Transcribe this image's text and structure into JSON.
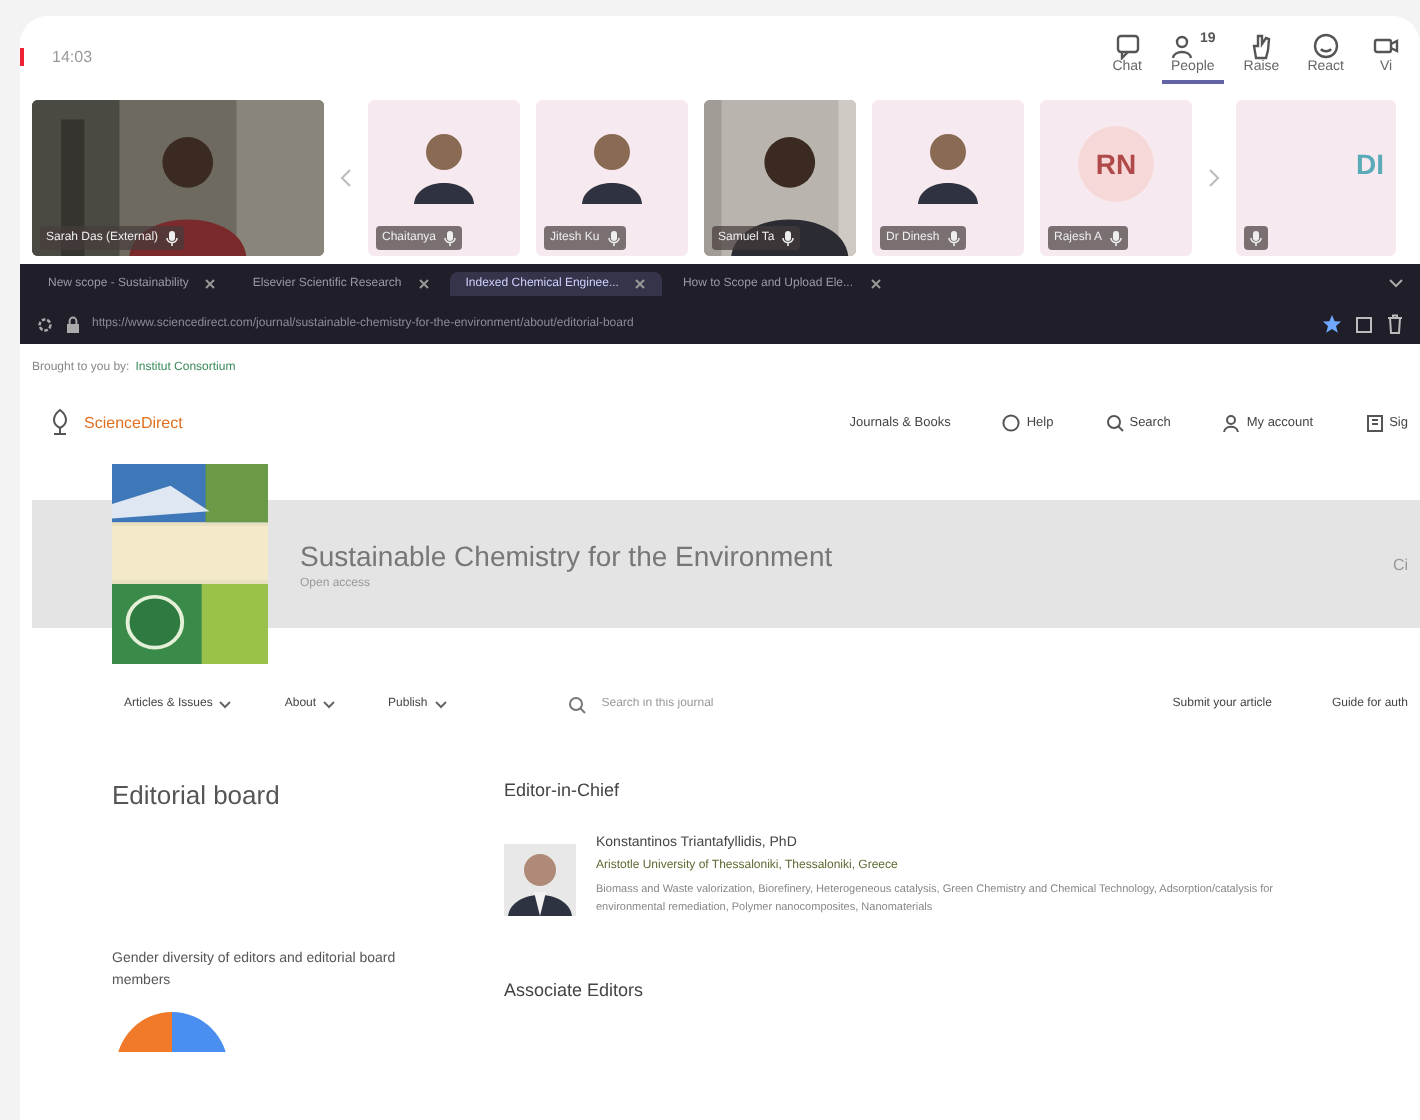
{
  "meeting": {
    "time": "14:03",
    "toolbar": [
      {
        "kind": "chat",
        "label": "Chat",
        "selected": false
      },
      {
        "kind": "people",
        "label": "People",
        "badge": "19",
        "selected": true
      },
      {
        "kind": "raise",
        "label": "Raise",
        "selected": false
      },
      {
        "kind": "react",
        "label": "React",
        "selected": false
      },
      {
        "kind": "view",
        "label": "Vi",
        "selected": false
      }
    ]
  },
  "video_tiles": [
    {
      "kind": "video",
      "name": "Sarah Das (External)",
      "speaking": true
    },
    {
      "name": "Chaitanya",
      "speaking": false
    },
    {
      "name": "Jitesh Ku",
      "speaking": false
    },
    {
      "kind": "video",
      "name": "Samuel Ta",
      "speaking": false
    },
    {
      "name": "Dr Dinesh",
      "speaking": false
    },
    {
      "kind": "initials",
      "initials": "RN",
      "name": "Rajesh A",
      "speaking": false
    },
    {
      "kind": "initials",
      "initials": "DI",
      "speaking": false
    }
  ],
  "browser": {
    "tabs": [
      {
        "label": "New scope - Sustainability",
        "selected": false
      },
      {
        "label": "Elsevier Scientific Research",
        "selected": false
      },
      {
        "label": "Indexed Chemical Enginee...",
        "selected": true
      },
      {
        "label": "How to Scope and Upload Ele...",
        "selected": false
      }
    ],
    "url": "https://www.sciencedirect.com/journal/sustainable-chemistry-for-the-environment/about/editorial-board"
  },
  "page": {
    "site_name": "ScienceDirect",
    "brought_by": "Brought to you by:",
    "institution": "Institut Consortium",
    "site_nav": [
      {
        "kind": "plain",
        "label": "Journals & Books"
      },
      {
        "kind": "help",
        "label": "Help"
      },
      {
        "kind": "search",
        "label": "Search"
      },
      {
        "kind": "account",
        "label": "My account"
      },
      {
        "kind": "signin",
        "label": "Sig"
      }
    ],
    "journal": {
      "title": "Sustainable Chemistry for the Environment",
      "subtitle": "Open access",
      "side": "Ci"
    },
    "journal_nav": [
      "Articles & Issues",
      "About",
      "Publish"
    ],
    "search": {
      "placeholder": "Search in this journal"
    },
    "journal_links": [
      "Submit your article",
      "Guide for auth"
    ],
    "heading": "Editorial board",
    "diversity_title": "Gender diversity of editors and editorial board members",
    "chief_heading": "Editor-in-Chief",
    "chief": {
      "name": "Konstantinos Triantafyllidis, PhD",
      "affiliation": "Aristotle University of Thessaloniki, Thessaloniki, Greece",
      "interests": "Biomass and Waste valorization, Biorefinery, Heterogeneous catalysis, Green Chemistry and Chemical Technology, Adsorption/catalysis for environmental remediation, Polymer nanocomposites, Nanomaterials"
    },
    "associate_heading": "Associate Editors"
  }
}
